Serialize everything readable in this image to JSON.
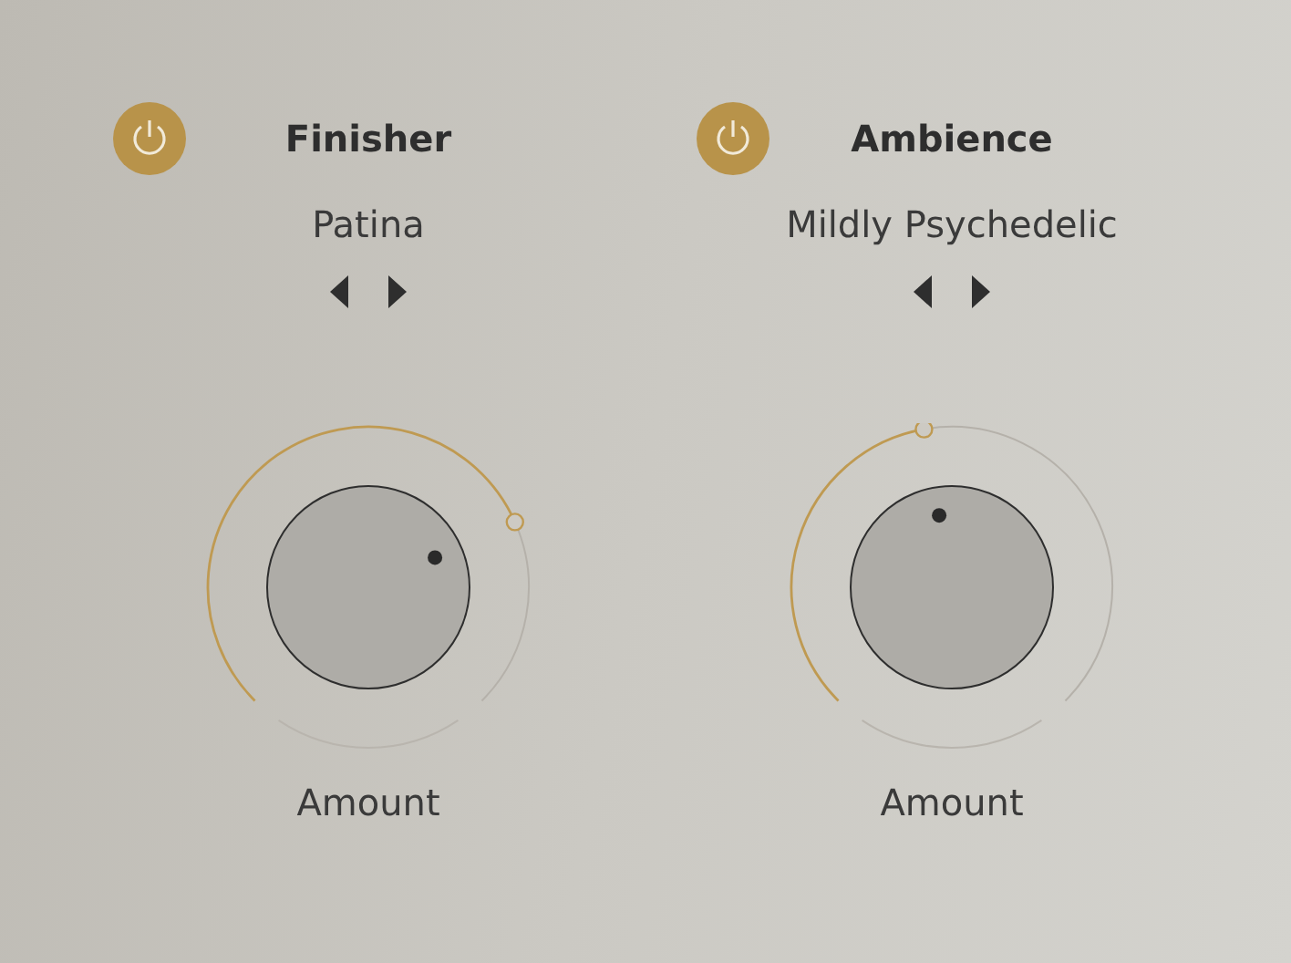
{
  "modules": [
    {
      "title": "Finisher",
      "on": true,
      "preset": "Patina",
      "knob": {
        "label": "Amount"
      }
    },
    {
      "title": "Ambience",
      "on": true,
      "preset": "Mildly Psychedelic",
      "knob": {
        "label": "Amount"
      }
    }
  ]
}
